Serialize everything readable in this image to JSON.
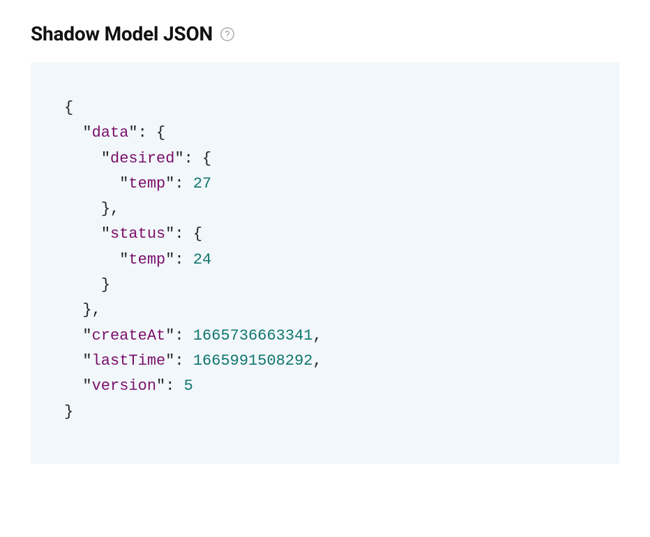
{
  "header": {
    "title": "Shadow Model JSON"
  },
  "json": {
    "keys": {
      "data": "data",
      "desired": "desired",
      "status": "status",
      "temp1": "temp",
      "temp2": "temp",
      "createAt": "createAt",
      "lastTime": "lastTime",
      "version": "version"
    },
    "values": {
      "desiredTemp": "27",
      "statusTemp": "24",
      "createAt": "1665736663341",
      "lastTime": "1665991508292",
      "version": "5"
    }
  }
}
